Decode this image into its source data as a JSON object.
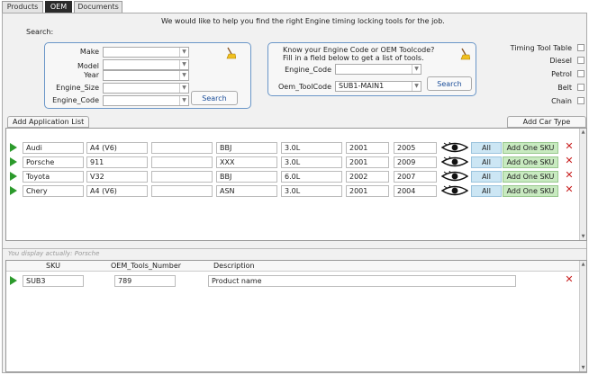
{
  "tabs": [
    {
      "label": "Products",
      "active": false
    },
    {
      "label": "OEM",
      "active": true
    },
    {
      "label": "Documents",
      "active": false
    }
  ],
  "intro": "We would like to help you find the right Engine timing locking tools for the job.",
  "search_label": "Search:",
  "vehicle_search": {
    "fields": [
      {
        "label": "Make",
        "value": ""
      },
      {
        "label": "Model",
        "value": ""
      },
      {
        "label": "Year",
        "value": ""
      },
      {
        "label": "Engine_Size",
        "value": ""
      },
      {
        "label": "Engine_Code",
        "value": ""
      }
    ],
    "search_button": "Search"
  },
  "code_search": {
    "heading_line1": "Know your Engine Code or OEM Toolcode?",
    "heading_line2": "Fill in a field below to get a list of tools.",
    "engine_code_label": "Engine_Code",
    "engine_code_value": "",
    "oem_toolcode_label": "Oem_ToolCode",
    "oem_toolcode_value": "SUB1-MAIN1",
    "search_button": "Search"
  },
  "filters": [
    {
      "label": "Timing Tool Table",
      "checked": false
    },
    {
      "label": "Diesel",
      "checked": false
    },
    {
      "label": "Petrol",
      "checked": false
    },
    {
      "label": "Belt",
      "checked": false
    },
    {
      "label": "Chain",
      "checked": false
    }
  ],
  "add_application_list": "Add Application List",
  "add_car_type": "Add  Car Type",
  "applications": [
    {
      "make": "Audi",
      "model": "A4 (V6)",
      "extra": "",
      "engine_code": "BBJ",
      "size": "3.0L",
      "year_from": "2001",
      "year_to": "2005",
      "all": "All",
      "add": "Add One SKU"
    },
    {
      "make": "Porsche",
      "model": "911",
      "extra": "",
      "engine_code": "XXX",
      "size": "3.0L",
      "year_from": "2001",
      "year_to": "2009",
      "all": "All",
      "add": "Add One SKU"
    },
    {
      "make": "Toyota",
      "model": "V32",
      "extra": "",
      "engine_code": "BBJ",
      "size": "6.0L",
      "year_from": "2002",
      "year_to": "2007",
      "all": "All",
      "add": "Add One SKU"
    },
    {
      "make": "Chery",
      "model": "A4 (V6)",
      "extra": "",
      "engine_code": "ASN",
      "size": "3.0L",
      "year_from": "2001",
      "year_to": "2004",
      "all": "All",
      "add": "Add One SKU"
    }
  ],
  "status_text": "You display actually:  Porsche",
  "sku_table": {
    "headers": {
      "sku": "SKU",
      "oem_tools_number": "OEM_Tools_Number",
      "description": "Description"
    },
    "rows": [
      {
        "sku": "SUB3",
        "oem_tools_number": "789",
        "description": "Product name"
      }
    ]
  },
  "colors": {
    "accent_blue": "#6a96c8",
    "play_green": "#2c9a2c",
    "add_green": "#c8eac0",
    "all_blue": "#cce6f4",
    "delete_red": "#c81e1e"
  }
}
